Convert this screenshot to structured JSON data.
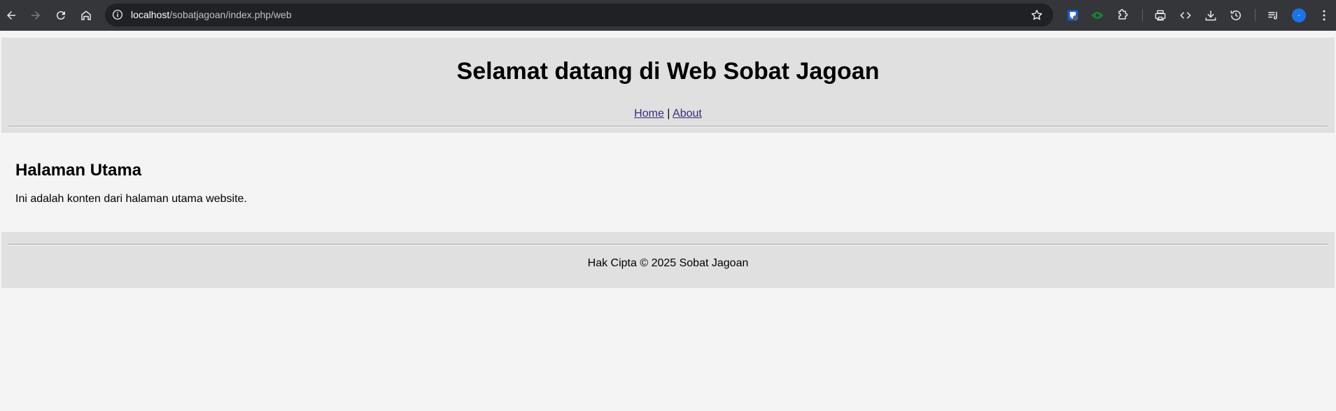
{
  "browser": {
    "url_host": "localhost",
    "url_path": "/sobatjagoan/index.php/web",
    "avatar_initial": "-"
  },
  "header": {
    "title": "Selamat datang di Web Sobat Jagoan",
    "nav": {
      "home_label": "Home",
      "separator": "|",
      "about_label": "About"
    }
  },
  "main": {
    "heading": "Halaman Utama",
    "text": "Ini adalah konten dari halaman utama website."
  },
  "footer": {
    "text": "Hak Cipta © 2025 Sobat Jagoan"
  },
  "colors": {
    "chrome_bg": "#35363a",
    "omnibox_bg": "#202124",
    "page_bg": "#f4f4f4",
    "panel_bg": "#e0e0e0",
    "link": "#3b2b7a"
  }
}
